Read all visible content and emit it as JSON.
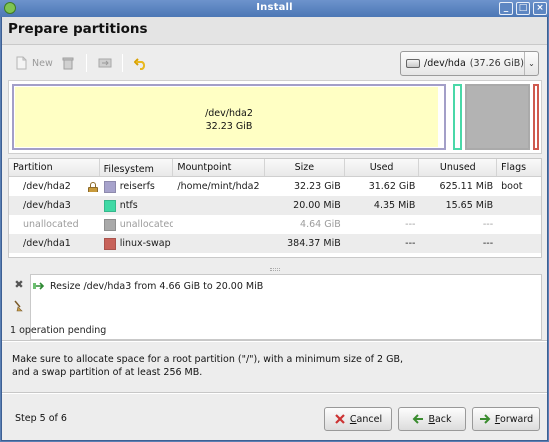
{
  "window": {
    "title": "Install"
  },
  "header": {
    "title": "Prepare partitions"
  },
  "toolbar": {
    "new_label": "New",
    "device": {
      "name": "/dev/hda",
      "size": "(37.26 GiB)"
    }
  },
  "diskmap": {
    "main_partition": {
      "name": "/dev/hda2",
      "size": "32.23 GiB"
    }
  },
  "partitions": {
    "columns": [
      "Partition",
      "Filesystem",
      "Mountpoint",
      "Size",
      "Used",
      "Unused",
      "Flags"
    ],
    "rows": [
      {
        "partition": "/dev/hda2",
        "filesystem": "reiserfs",
        "color": "#a7a3cc",
        "mountpoint": "/home/mint/hda2",
        "size": "32.23 GiB",
        "used": "31.62 GiB",
        "unused": "625.11 MiB",
        "flags": "boot",
        "locked": true
      },
      {
        "partition": "/dev/hda3",
        "filesystem": "ntfs",
        "color": "#3fd9a5",
        "mountpoint": "",
        "size": "20.00 MiB",
        "used": "4.35 MiB",
        "unused": "15.65 MiB",
        "flags": ""
      },
      {
        "partition": "unallocated",
        "filesystem": "unallocated",
        "color": "#a9a9a9",
        "mountpoint": "",
        "size": "4.64 GiB",
        "used": "---",
        "unused": "---",
        "flags": ""
      },
      {
        "partition": "/dev/hda1",
        "filesystem": "linux-swap",
        "color": "#c8625a",
        "mountpoint": "",
        "size": "384.37 MiB",
        "used": "---",
        "unused": "---",
        "flags": ""
      }
    ]
  },
  "operations": {
    "items": [
      "Resize /dev/hda3 from 4.66 GiB to 20.00 MiB"
    ],
    "pending": "1 operation pending"
  },
  "info": "Make sure to allocate space for a root partition (\"/\"), with a minimum size of 2 GB, and a swap partition of at least 256 MB.",
  "footer": {
    "step": "Step 5 of 6",
    "cancel_key": "C",
    "cancel_rest": "ancel",
    "back_key": "B",
    "back_rest": "ack",
    "forward_key": "F",
    "forward_rest": "orward"
  }
}
